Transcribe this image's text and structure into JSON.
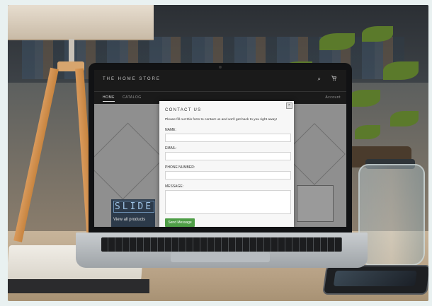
{
  "store": {
    "name": "THE HOME STORE",
    "nav": [
      "HOME",
      "CATALOG",
      "Account"
    ]
  },
  "slide": {
    "word": "SLIDE",
    "cta": "View all products"
  },
  "modal": {
    "title": "CONTACT US",
    "intro": "Please fill out this form to contact us and we'll get back to you right away!",
    "fields": {
      "name_label": "NAME:",
      "email_label": "EMAIL:",
      "phone_label": "PHONE NUMBER:",
      "message_label": "MESSAGE:"
    },
    "send_label": "Send Message",
    "close_glyph": "×"
  },
  "icons": {
    "search": "⌕",
    "cart": "🛒"
  }
}
